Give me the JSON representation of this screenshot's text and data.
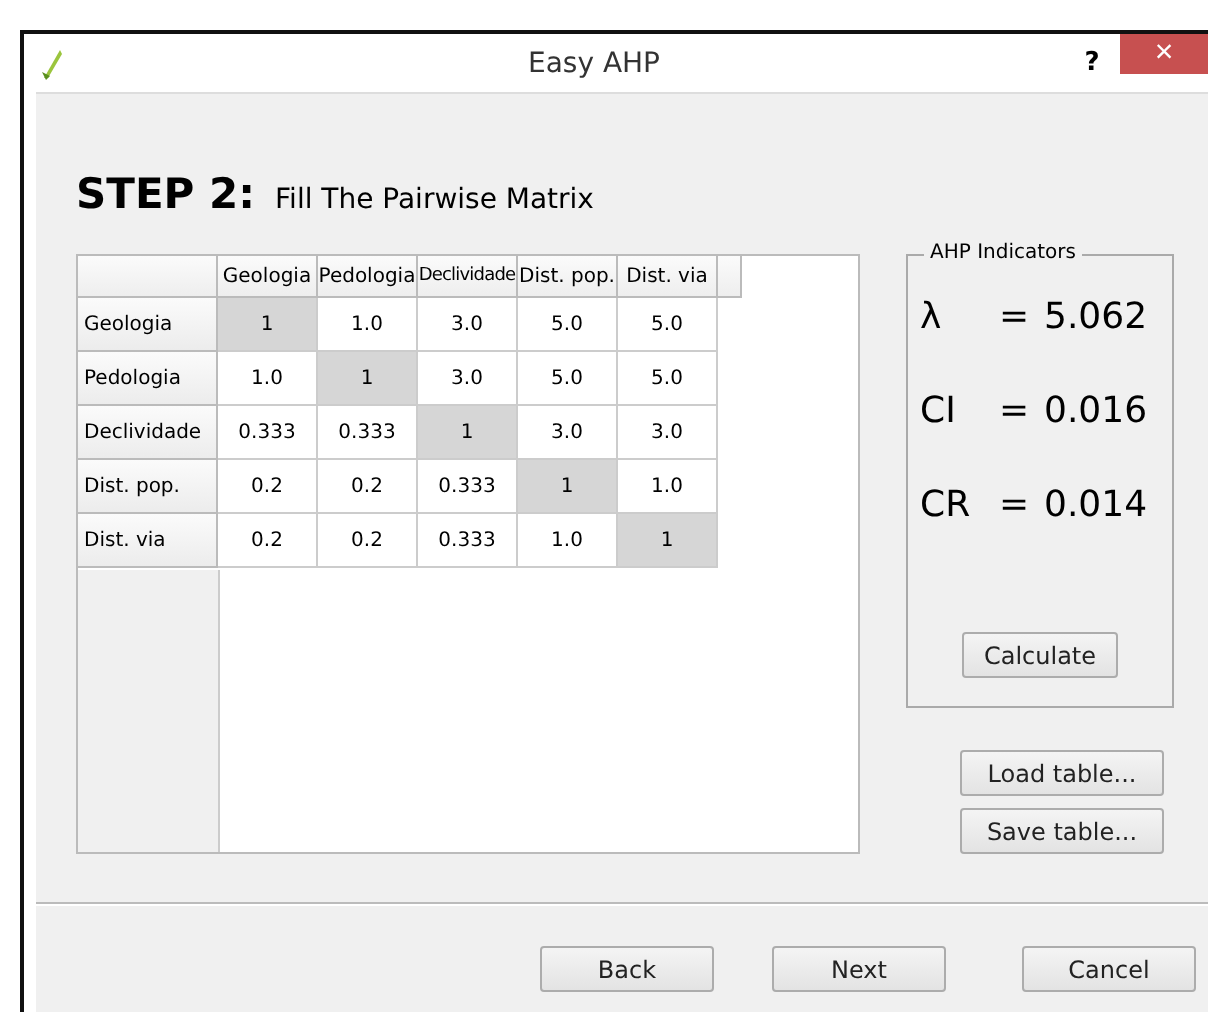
{
  "window": {
    "title": "Easy AHP",
    "help": "?",
    "close": "×"
  },
  "step": {
    "label": "STEP 2:",
    "title": "Fill The Pairwise Matrix"
  },
  "matrix": {
    "columns": [
      "Geologia",
      "Pedologia",
      "Declividade",
      "Dist. pop.",
      "Dist. via"
    ],
    "rows": [
      {
        "header": "Geologia",
        "cells": [
          "1",
          "1.0",
          "3.0",
          "5.0",
          "5.0"
        ]
      },
      {
        "header": "Pedologia",
        "cells": [
          "1.0",
          "1",
          "3.0",
          "5.0",
          "5.0"
        ]
      },
      {
        "header": "Declividade",
        "cells": [
          "0.333",
          "0.333",
          "1",
          "3.0",
          "3.0"
        ]
      },
      {
        "header": "Dist. pop.",
        "cells": [
          "0.2",
          "0.2",
          "0.333",
          "1",
          "1.0"
        ]
      },
      {
        "header": "Dist. via",
        "cells": [
          "0.2",
          "0.2",
          "0.333",
          "1.0",
          "1"
        ]
      }
    ]
  },
  "indicators": {
    "title": "AHP Indicators",
    "items": [
      {
        "symbol": "λ",
        "equals": "=",
        "value": "5.062"
      },
      {
        "symbol": "CI",
        "equals": "=",
        "value": "0.016"
      },
      {
        "symbol": "CR",
        "equals": "=",
        "value": "0.014"
      }
    ],
    "button": "Calculate"
  },
  "table_buttons": [
    "Load table...",
    "Save table..."
  ],
  "footer_buttons": [
    "Back",
    "Next",
    "Cancel"
  ]
}
